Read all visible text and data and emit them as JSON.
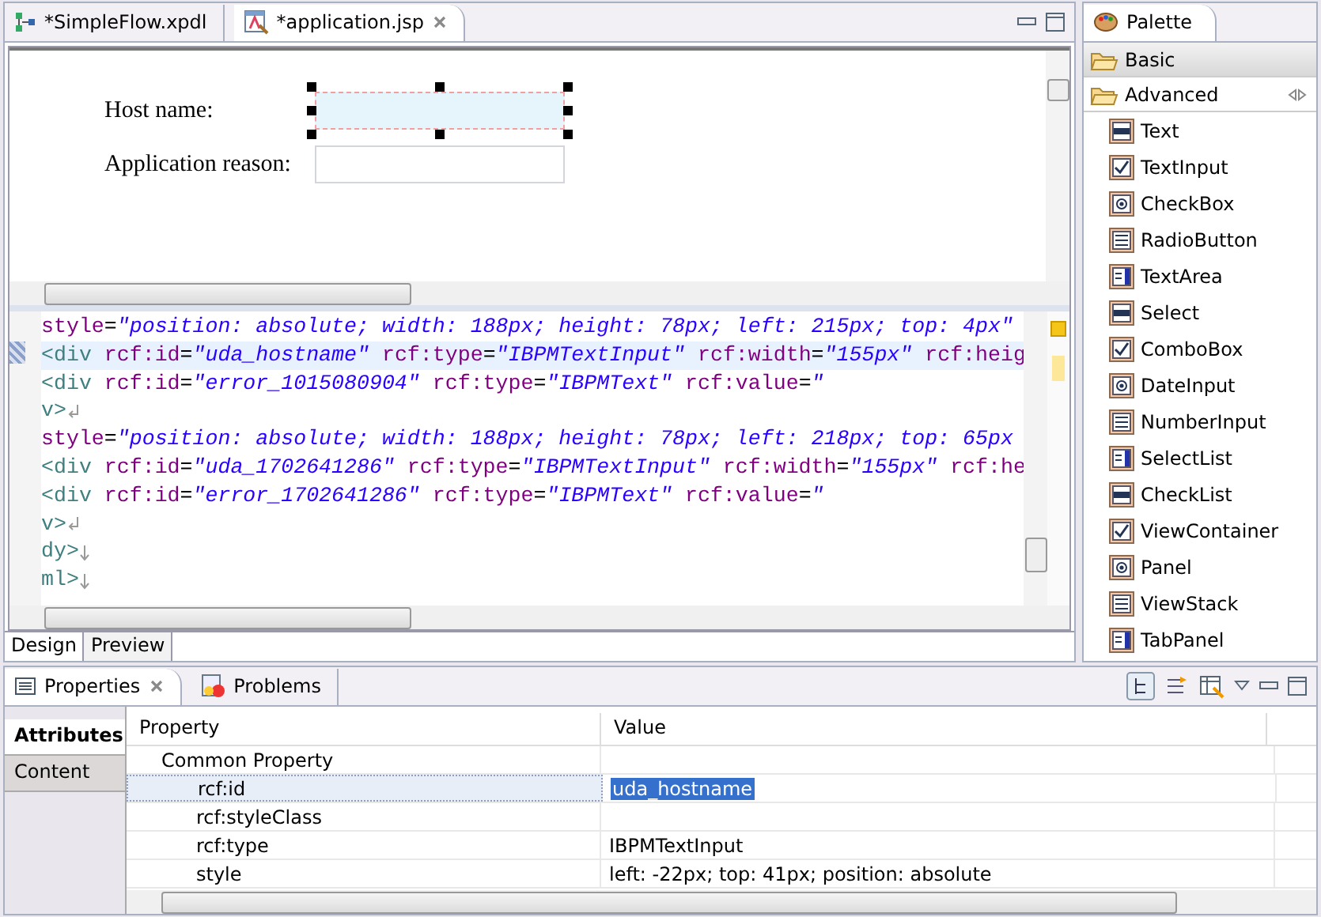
{
  "editor": {
    "tabs": [
      {
        "label": "*SimpleFlow.xpdl",
        "selected": false,
        "kind": "flow"
      },
      {
        "label": "*application.jsp",
        "selected": true,
        "kind": "page"
      }
    ],
    "design_form": {
      "fields": [
        {
          "label": "Host name:",
          "selected": true
        },
        {
          "label": "Application reason:",
          "selected": false
        }
      ]
    },
    "source_lines": [
      {
        "current": false,
        "segments": [
          {
            "kind": "attr",
            "text": "style"
          },
          {
            "kind": "punct",
            "text": "="
          },
          {
            "kind": "value",
            "text": "\"position: absolute; width: 188px; height: 78px; left: 215px; top: 4px\""
          }
        ]
      },
      {
        "current": true,
        "segments": [
          {
            "kind": "tag",
            "text": "<div"
          },
          {
            "kind": "attr",
            "text": " rcf:id"
          },
          {
            "kind": "punct",
            "text": "="
          },
          {
            "kind": "value",
            "text": "\"uda_hostname\""
          },
          {
            "kind": "attr",
            "text": " rcf:type"
          },
          {
            "kind": "punct",
            "text": "="
          },
          {
            "kind": "value",
            "text": "\"IBPMTextInput\""
          },
          {
            "kind": "attr",
            "text": " rcf:width"
          },
          {
            "kind": "punct",
            "text": "="
          },
          {
            "kind": "value",
            "text": "\"155px\""
          },
          {
            "kind": "attr",
            "text": " rcf:heig"
          }
        ]
      },
      {
        "current": false,
        "segments": [
          {
            "kind": "tag",
            "text": "<div"
          },
          {
            "kind": "attr",
            "text": " rcf:id"
          },
          {
            "kind": "punct",
            "text": "="
          },
          {
            "kind": "value",
            "text": "\"error_1015080904\""
          },
          {
            "kind": "attr",
            "text": " rcf:type"
          },
          {
            "kind": "punct",
            "text": "="
          },
          {
            "kind": "value",
            "text": "\"IBPMText\""
          },
          {
            "kind": "attr",
            "text": " rcf:value"
          },
          {
            "kind": "punct",
            "text": "="
          },
          {
            "kind": "value",
            "text": "\""
          }
        ]
      },
      {
        "current": false,
        "break_mark": true,
        "segments": [
          {
            "kind": "tag",
            "text": "v>"
          }
        ]
      },
      {
        "current": false,
        "segments": [
          {
            "kind": "attr",
            "text": "style"
          },
          {
            "kind": "punct",
            "text": "="
          },
          {
            "kind": "value",
            "text": "\"position: absolute; width: 188px; height: 78px; left: 218px; top: 65px"
          }
        ]
      },
      {
        "current": false,
        "segments": [
          {
            "kind": "tag",
            "text": "<div"
          },
          {
            "kind": "attr",
            "text": " rcf:id"
          },
          {
            "kind": "punct",
            "text": "="
          },
          {
            "kind": "value",
            "text": "\"uda_1702641286\""
          },
          {
            "kind": "attr",
            "text": " rcf:type"
          },
          {
            "kind": "punct",
            "text": "="
          },
          {
            "kind": "value",
            "text": "\"IBPMTextInput\""
          },
          {
            "kind": "attr",
            "text": " rcf:width"
          },
          {
            "kind": "punct",
            "text": "="
          },
          {
            "kind": "value",
            "text": "\"155px\""
          },
          {
            "kind": "attr",
            "text": " rcf:he"
          }
        ]
      },
      {
        "current": false,
        "segments": [
          {
            "kind": "tag",
            "text": "<div"
          },
          {
            "kind": "attr",
            "text": " rcf:id"
          },
          {
            "kind": "punct",
            "text": "="
          },
          {
            "kind": "value",
            "text": "\"error_1702641286\""
          },
          {
            "kind": "attr",
            "text": " rcf:type"
          },
          {
            "kind": "punct",
            "text": "="
          },
          {
            "kind": "value",
            "text": "\"IBPMText\""
          },
          {
            "kind": "attr",
            "text": " rcf:value"
          },
          {
            "kind": "punct",
            "text": "="
          },
          {
            "kind": "value",
            "text": "\""
          }
        ]
      },
      {
        "current": false,
        "break_mark": true,
        "segments": [
          {
            "kind": "tag",
            "text": "v>"
          }
        ]
      },
      {
        "current": false,
        "end_mark": true,
        "segments": [
          {
            "kind": "tag",
            "text": "dy>"
          }
        ]
      },
      {
        "current": false,
        "end_mark": true,
        "segments": [
          {
            "kind": "tag",
            "text": "ml>"
          }
        ]
      }
    ],
    "mode_tabs": [
      {
        "label": "Design",
        "selected": true
      },
      {
        "label": "Preview",
        "selected": false
      }
    ]
  },
  "palette": {
    "title": "Palette",
    "drawers": [
      {
        "label": "Basic",
        "expanded": false
      },
      {
        "label": "Advanced",
        "expanded": true,
        "items": [
          "Text",
          "TextInput",
          "CheckBox",
          "RadioButton",
          "TextArea",
          "Select",
          "ComboBox",
          "DateInput",
          "NumberInput",
          "SelectList",
          "CheckList",
          "ViewContainer",
          "Panel",
          "ViewStack",
          "TabPanel"
        ]
      }
    ]
  },
  "properties": {
    "tabs": [
      {
        "label": "Properties",
        "selected": true,
        "kind": "properties"
      },
      {
        "label": "Problems",
        "selected": false,
        "kind": "problems"
      }
    ],
    "sections": [
      {
        "label": "Attributes",
        "selected": true
      },
      {
        "label": "Content",
        "selected": false
      }
    ],
    "columns": [
      "Property",
      "Value"
    ],
    "rows": [
      {
        "name": "Common Property",
        "selected": false,
        "children": [
          {
            "name": "rcf:id",
            "value": "uda_hostname",
            "selected": true
          },
          {
            "name": "rcf:styleClass",
            "selected": false
          },
          {
            "name": "rcf:type",
            "value": "IBPMTextInput",
            "selected": false
          },
          {
            "name": "style",
            "value": "left: -22px; top: 41px; position: absolute",
            "selected": false
          }
        ]
      }
    ]
  }
}
